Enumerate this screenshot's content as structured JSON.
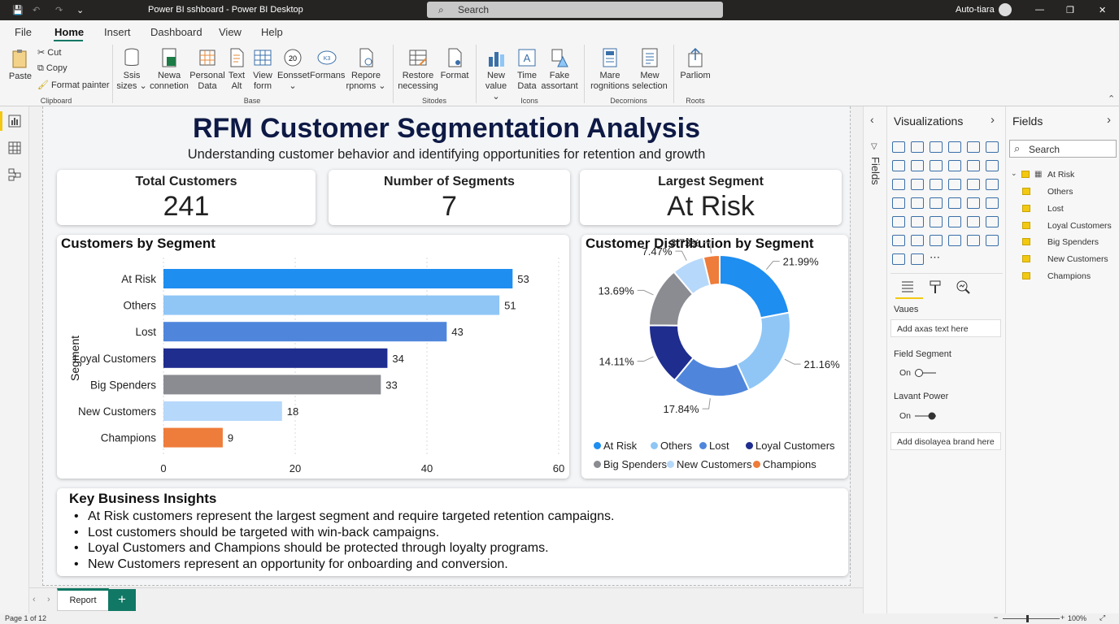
{
  "titlebar": {
    "title": "Power BI sshboard - Power BI Desktop",
    "search": "Search",
    "user": "Auto-tiara"
  },
  "menu": [
    "File",
    "Home",
    "Insert",
    "Dashboard",
    "View",
    "Help"
  ],
  "ribbon": {
    "paste": "Paste",
    "cut": "Cut",
    "copy": "Copy",
    "format_painter": "Format painter",
    "groups": {
      "clipboard": "Clipboard",
      "base": "Base",
      "sitodes": "Sitodes",
      "icons": "Icons",
      "decornions": "Decornions",
      "roots": "Roots"
    },
    "buttons": [
      {
        "l1": "Ssis",
        "l2": "sizes ⌄"
      },
      {
        "l1": "Newa",
        "l2": "connetion"
      },
      {
        "l1": "Personal",
        "l2": "Data"
      },
      {
        "l1": "Text",
        "l2": "Alt"
      },
      {
        "l1": "View",
        "l2": "form"
      },
      {
        "l1": "Eonsset",
        "l2": "⌄"
      },
      {
        "l1": "Formans",
        "l2": ""
      },
      {
        "l1": "Repore",
        "l2": "rpnoms ⌄"
      },
      {
        "l1": "Restore",
        "l2": "necessing"
      },
      {
        "l1": "Format",
        "l2": ""
      },
      {
        "l1": "New",
        "l2": "value ⌄"
      },
      {
        "l1": "Time",
        "l2": "Data"
      },
      {
        "l1": "Fake",
        "l2": "assortant"
      },
      {
        "l1": "Mare",
        "l2": "rognitions"
      },
      {
        "l1": "Mew",
        "l2": "selection"
      },
      {
        "l1": "Parliom",
        "l2": ""
      }
    ]
  },
  "report": {
    "title": "RFM Customer Segmentation Analysis",
    "subtitle": "Understanding customer behavior and identifying opportunities for retention and growth",
    "kpis": [
      {
        "label": "Total Customers",
        "value": "241"
      },
      {
        "label": "Number of Segments",
        "value": "7"
      },
      {
        "label": "Largest Segment",
        "value": "At Risk"
      }
    ],
    "insights_title": "Key Business Insights",
    "insights": [
      "At Risk customers represent the largest segment and require targeted retention campaigns.",
      "Lost customers should be targeted with win-back campaigns.",
      "Loyal Customers and Champions should be protected through loyalty programs.",
      "New Customers represent an opportunity for onboarding and conversion."
    ]
  },
  "chart_data": [
    {
      "type": "bar",
      "orientation": "horizontal",
      "title": "Customers by Segment",
      "ylabel": "Segment",
      "xlabel": "",
      "categories": [
        "At Risk",
        "Others",
        "Lost",
        "Loyal Customers",
        "Big Spenders",
        "New Customers",
        "Champions"
      ],
      "values": [
        53,
        51,
        43,
        34,
        33,
        18,
        9
      ],
      "colors": [
        "#1e8ef0",
        "#8fc6f6",
        "#4f86dc",
        "#1f2d8f",
        "#8a8c91",
        "#b6d8fa",
        "#ee7c3a"
      ],
      "xlim": [
        0,
        60
      ],
      "xticks": [
        0,
        20,
        40,
        60
      ],
      "grid": true
    },
    {
      "type": "pie",
      "donut": true,
      "title": "Customer Distribution by Segment",
      "categories": [
        "At Risk",
        "Others",
        "Lost",
        "Loyal Customers",
        "Big Spenders",
        "New Customers",
        "Champions"
      ],
      "values": [
        21.99,
        21.16,
        17.84,
        14.11,
        13.69,
        7.47,
        3.73
      ],
      "labels": [
        "21.99%",
        "21.16%",
        "17.84%",
        "14.11%",
        "13.69%",
        "7.47%",
        "3.73%"
      ],
      "colors": [
        "#1e8ef0",
        "#8fc6f6",
        "#4f86dc",
        "#1f2d8f",
        "#8a8c91",
        "#b6d8fa",
        "#ee7c3a"
      ],
      "legend_position": "bottom"
    }
  ],
  "visualizations": {
    "title": "Visualizations",
    "values_label": "Vaues",
    "add_axis": "Add axas text here",
    "field_segment": "Field Segment",
    "toggle1": "On",
    "lavant_power": "Lavant Power",
    "toggle2": "On",
    "add_brand": "Add disolayea brand here"
  },
  "fields": {
    "title": "Fields",
    "search": "Search",
    "strip_label": "Fields",
    "table": "At Risk",
    "items": [
      "Others",
      "Lost",
      "Loyal Customers",
      "Big Spenders",
      "New Customers",
      "Champions"
    ]
  },
  "tabs": {
    "report": "Report",
    "add": "+"
  },
  "status": {
    "page": "Page 1 of 12",
    "zoom": "100%"
  }
}
